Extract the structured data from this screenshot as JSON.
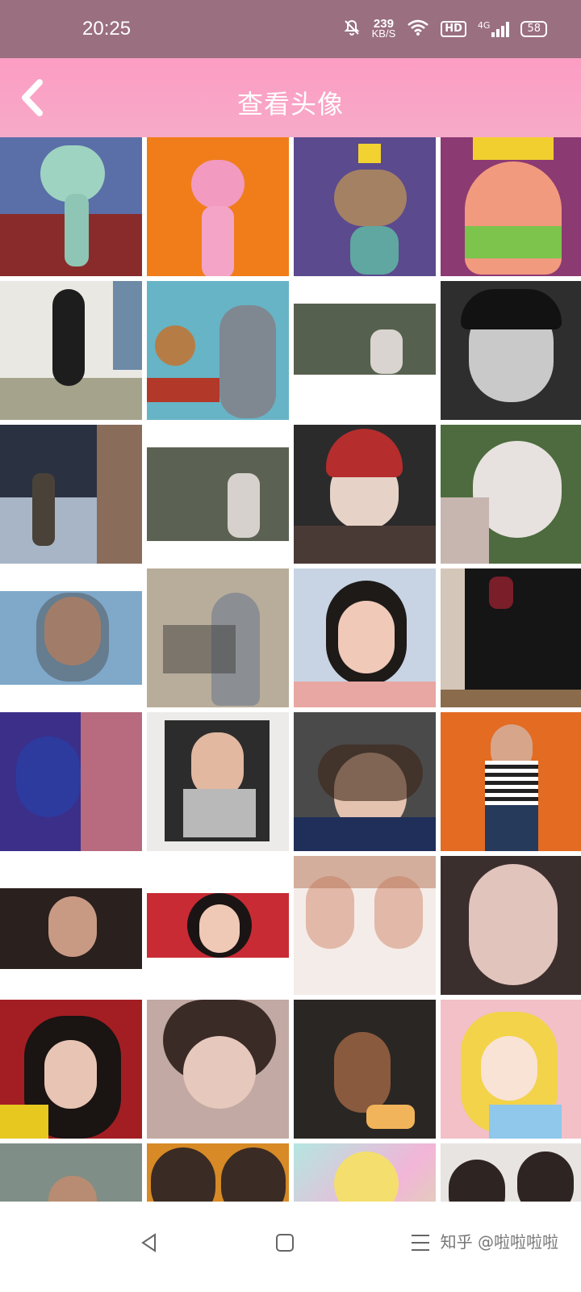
{
  "status_bar": {
    "time": "20:25",
    "net_speed_value": "239",
    "net_speed_unit": "KB/S",
    "hd_badge": "HD",
    "network_type": "4G",
    "battery_level": "58",
    "icons": [
      "bell-off-icon",
      "wifi-icon",
      "signal-icon",
      "battery-icon"
    ]
  },
  "header": {
    "title": "查看头像",
    "back_icon": "chevron-left-icon",
    "background_color": "#fc9dc3"
  },
  "grid": {
    "columns": 4,
    "tiles": [
      {
        "name": "avatar-squidward"
      },
      {
        "name": "avatar-pink-panther"
      },
      {
        "name": "avatar-mouse-king"
      },
      {
        "name": "avatar-patrick"
      },
      {
        "name": "avatar-daffy-duck"
      },
      {
        "name": "avatar-tom-jerry"
      },
      {
        "name": "avatar-garden-boy"
      },
      {
        "name": "avatar-vintage-woman"
      },
      {
        "name": "avatar-night-street"
      },
      {
        "name": "avatar-garden-boy-2"
      },
      {
        "name": "avatar-red-beanie-girl"
      },
      {
        "name": "avatar-white-cat"
      },
      {
        "name": "avatar-smiling-girl"
      },
      {
        "name": "avatar-ink-painting"
      },
      {
        "name": "avatar-glasses-girl"
      },
      {
        "name": "avatar-wine-glass"
      },
      {
        "name": "avatar-blue-profile"
      },
      {
        "name": "avatar-polaroid-girl"
      },
      {
        "name": "avatar-lying-girl"
      },
      {
        "name": "avatar-striped-top"
      },
      {
        "name": "avatar-dark-portrait"
      },
      {
        "name": "avatar-laughing-girl"
      },
      {
        "name": "avatar-twin-portrait"
      },
      {
        "name": "avatar-pale-woman"
      },
      {
        "name": "avatar-hair-girl"
      },
      {
        "name": "avatar-soft-girl"
      },
      {
        "name": "avatar-cake-girl"
      },
      {
        "name": "avatar-alice"
      },
      {
        "name": "avatar-window-girl"
      },
      {
        "name": "avatar-couple"
      },
      {
        "name": "avatar-sailor-moon"
      },
      {
        "name": "avatar-photo-strip"
      }
    ]
  },
  "nav_bar": {
    "icons": [
      "back-triangle-icon",
      "home-square-icon",
      "menu-lines-icon"
    ],
    "watermark": "知乎 @啦啦啦啦"
  }
}
